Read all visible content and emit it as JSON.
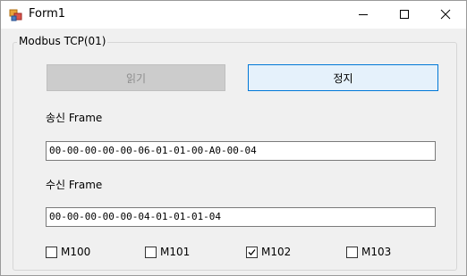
{
  "window": {
    "title": "Form1",
    "icon": "winforms-app-icon",
    "controls": {
      "minimize": "minimize-icon",
      "maximize": "maximize-icon",
      "close": "close-icon"
    }
  },
  "group": {
    "title": "Modbus TCP(01)",
    "read_button": {
      "label": "읽기",
      "enabled": false
    },
    "stop_button": {
      "label": "정지"
    },
    "send_label": "송신 Frame",
    "send_value": "00-00-00-00-00-06-01-01-00-A0-00-04",
    "recv_label": "수신 Frame",
    "recv_value": "00-00-00-00-00-04-01-01-01-04",
    "checkboxes": [
      {
        "label": "M100",
        "checked": false
      },
      {
        "label": "M101",
        "checked": false
      },
      {
        "label": "M102",
        "checked": true
      },
      {
        "label": "M103",
        "checked": false
      }
    ]
  },
  "colors": {
    "accent": "#0078d7",
    "stop_button_bg": "#e5f1fb",
    "disabled_bg": "#cccccc",
    "window_bg": "#f0f0f0"
  }
}
